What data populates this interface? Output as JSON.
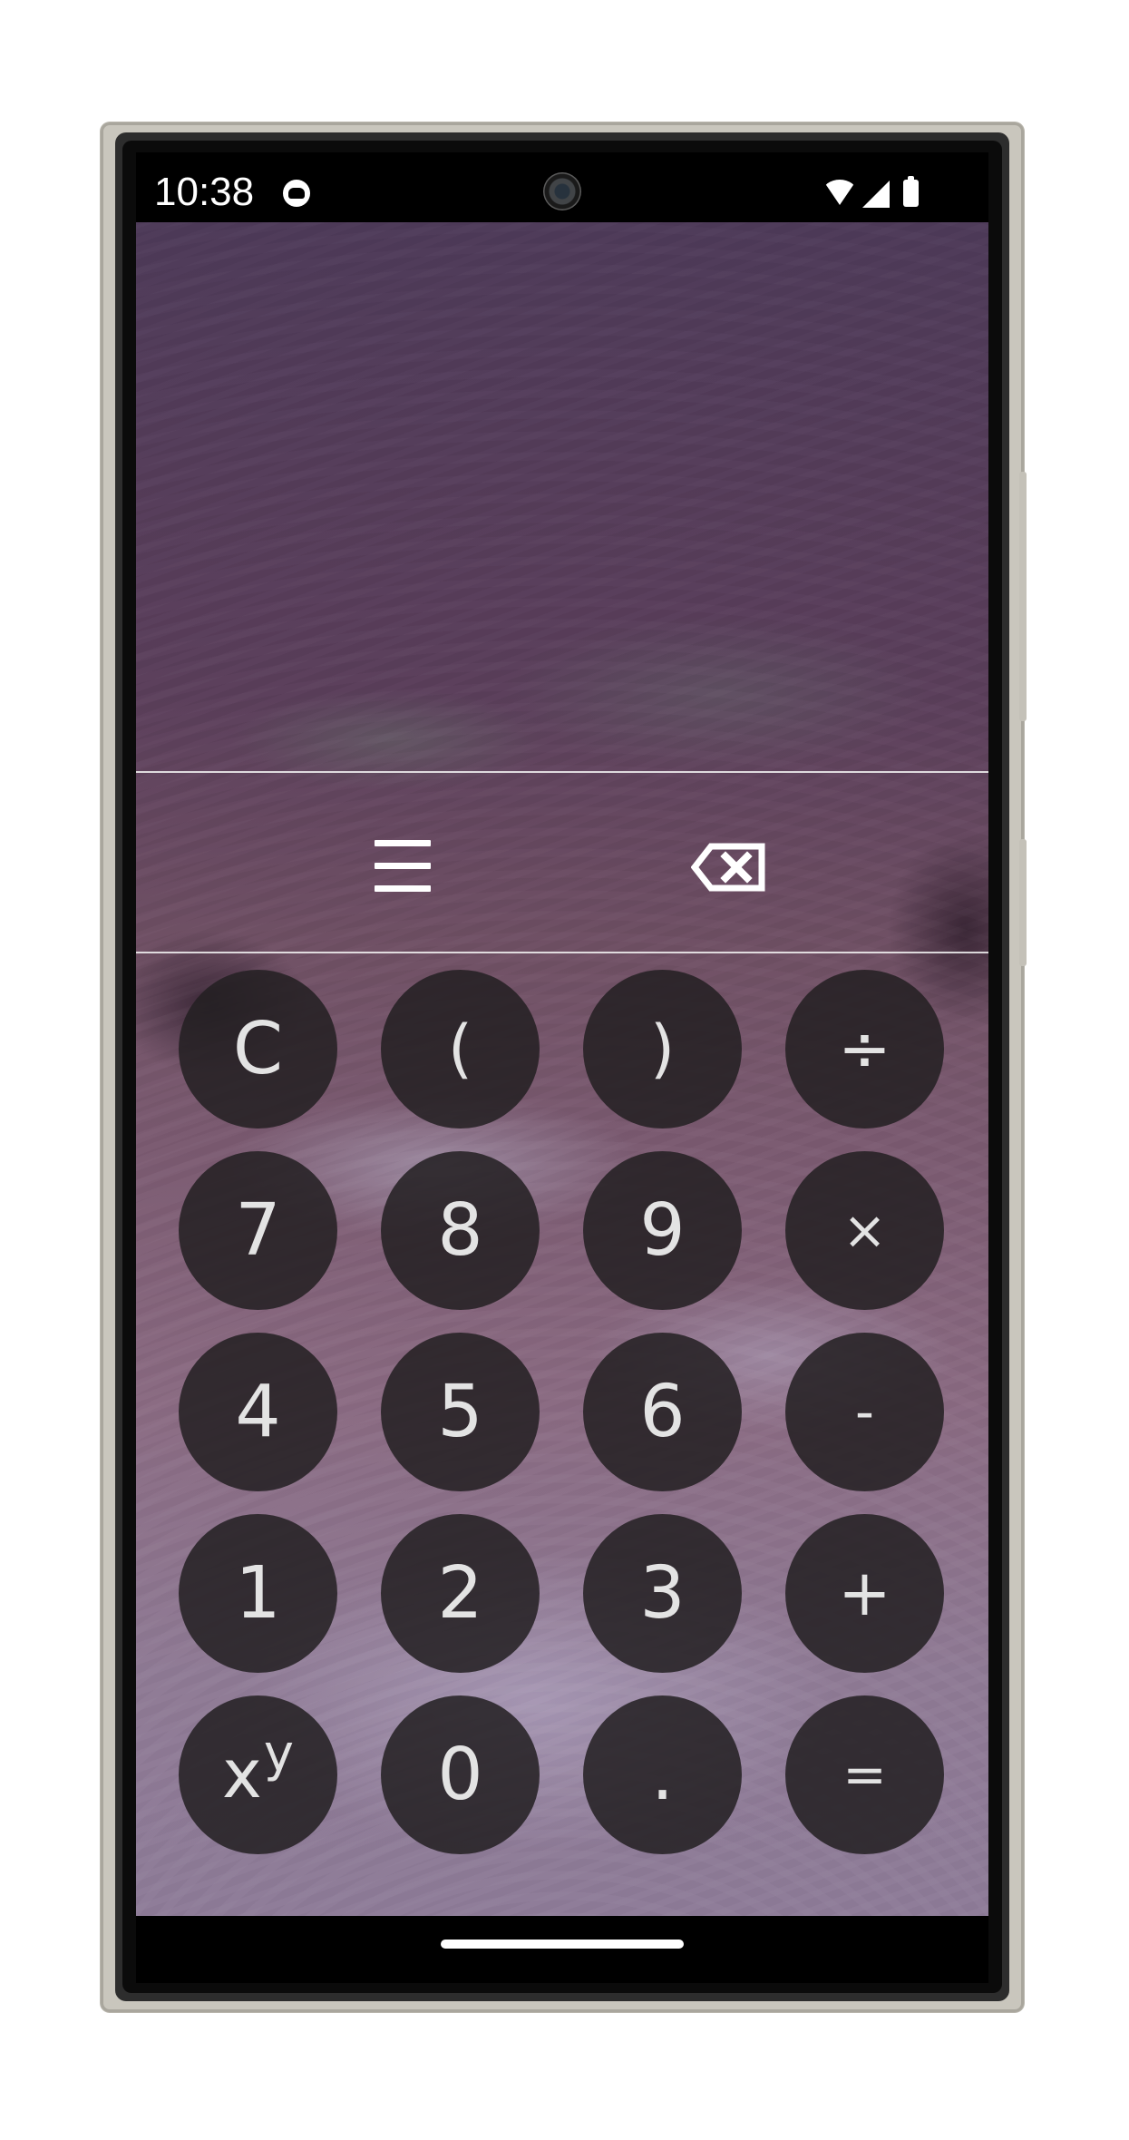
{
  "status_bar": {
    "time": "10:38",
    "icons": {
      "app": "android-face-icon",
      "camera": "front-camera-icon",
      "wifi": "wifi-icon",
      "signal": "cellular-signal-icon",
      "battery": "battery-icon"
    }
  },
  "calculator": {
    "display_value": "",
    "toolbar": {
      "menu_icon": "menu-icon",
      "backspace_icon": "backspace-icon"
    },
    "keys": [
      {
        "label": "C",
        "name": "clear-key"
      },
      {
        "label": "(",
        "name": "open-paren-key"
      },
      {
        "label": ")",
        "name": "close-paren-key"
      },
      {
        "label": "÷",
        "name": "divide-key"
      },
      {
        "label": "7",
        "name": "seven-key"
      },
      {
        "label": "8",
        "name": "eight-key"
      },
      {
        "label": "9",
        "name": "nine-key"
      },
      {
        "label": "×",
        "name": "multiply-key"
      },
      {
        "label": "4",
        "name": "four-key"
      },
      {
        "label": "5",
        "name": "five-key"
      },
      {
        "label": "6",
        "name": "six-key"
      },
      {
        "label": "-",
        "name": "subtract-key"
      },
      {
        "label": "1",
        "name": "one-key"
      },
      {
        "label": "2",
        "name": "two-key"
      },
      {
        "label": "3",
        "name": "three-key"
      },
      {
        "label": "+",
        "name": "add-key"
      },
      {
        "label_base": "x",
        "label_superscript": "y",
        "name": "power-key"
      },
      {
        "label": "0",
        "name": "zero-key"
      },
      {
        "label": ".",
        "name": "decimal-key"
      },
      {
        "label": "=",
        "name": "equals-key"
      }
    ]
  },
  "colors": {
    "key_background": "#231f22",
    "key_text": "#e3e3e3",
    "wallpaper_tint": "#5b3f5b",
    "toolbar_icon": "#ffffff",
    "separator": "#f5f5f5"
  }
}
